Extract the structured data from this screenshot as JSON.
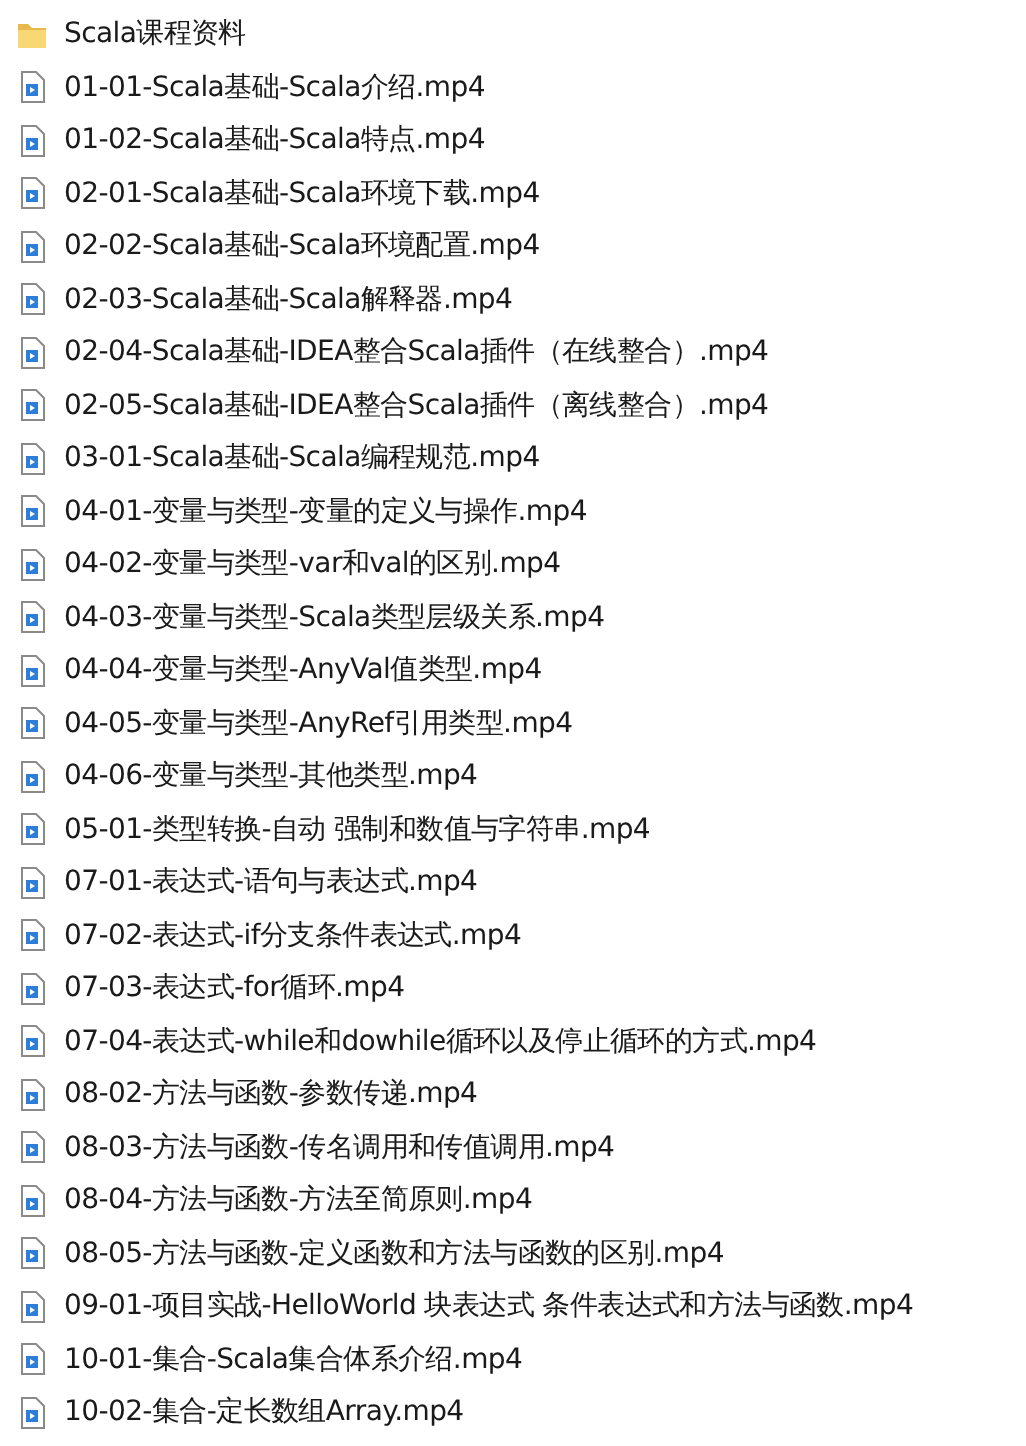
{
  "items": [
    {
      "kind": "folder",
      "name": "Scala课程资料"
    },
    {
      "kind": "video",
      "name": "01-01-Scala基础-Scala介绍.mp4"
    },
    {
      "kind": "video",
      "name": "01-02-Scala基础-Scala特点.mp4"
    },
    {
      "kind": "video",
      "name": "02-01-Scala基础-Scala环境下载.mp4"
    },
    {
      "kind": "video",
      "name": "02-02-Scala基础-Scala环境配置.mp4"
    },
    {
      "kind": "video",
      "name": "02-03-Scala基础-Scala解释器.mp4"
    },
    {
      "kind": "video",
      "name": "02-04-Scala基础-IDEA整合Scala插件（在线整合）.mp4"
    },
    {
      "kind": "video",
      "name": "02-05-Scala基础-IDEA整合Scala插件（离线整合）.mp4"
    },
    {
      "kind": "video",
      "name": "03-01-Scala基础-Scala编程规范.mp4"
    },
    {
      "kind": "video",
      "name": "04-01-变量与类型-变量的定义与操作.mp4"
    },
    {
      "kind": "video",
      "name": "04-02-变量与类型-var和val的区别.mp4"
    },
    {
      "kind": "video",
      "name": "04-03-变量与类型-Scala类型层级关系.mp4"
    },
    {
      "kind": "video",
      "name": "04-04-变量与类型-AnyVal值类型.mp4"
    },
    {
      "kind": "video",
      "name": "04-05-变量与类型-AnyRef引用类型.mp4"
    },
    {
      "kind": "video",
      "name": "04-06-变量与类型-其他类型.mp4"
    },
    {
      "kind": "video",
      "name": "05-01-类型转换-自动 强制和数值与字符串.mp4"
    },
    {
      "kind": "video",
      "name": "07-01-表达式-语句与表达式.mp4"
    },
    {
      "kind": "video",
      "name": "07-02-表达式-if分支条件表达式.mp4"
    },
    {
      "kind": "video",
      "name": "07-03-表达式-for循环.mp4"
    },
    {
      "kind": "video",
      "name": "07-04-表达式-while和dowhile循环以及停止循环的方式.mp4"
    },
    {
      "kind": "video",
      "name": "08-02-方法与函数-参数传递.mp4"
    },
    {
      "kind": "video",
      "name": "08-03-方法与函数-传名调用和传值调用.mp4"
    },
    {
      "kind": "video",
      "name": "08-04-方法与函数-方法至简原则.mp4"
    },
    {
      "kind": "video",
      "name": "08-05-方法与函数-定义函数和方法与函数的区别.mp4"
    },
    {
      "kind": "video",
      "name": "09-01-项目实战-HelloWorld 块表达式 条件表达式和方法与函数.mp4"
    },
    {
      "kind": "video",
      "name": "10-01-集合-Scala集合体系介绍.mp4"
    },
    {
      "kind": "video",
      "name": "10-02-集合-定长数组Array.mp4"
    }
  ]
}
